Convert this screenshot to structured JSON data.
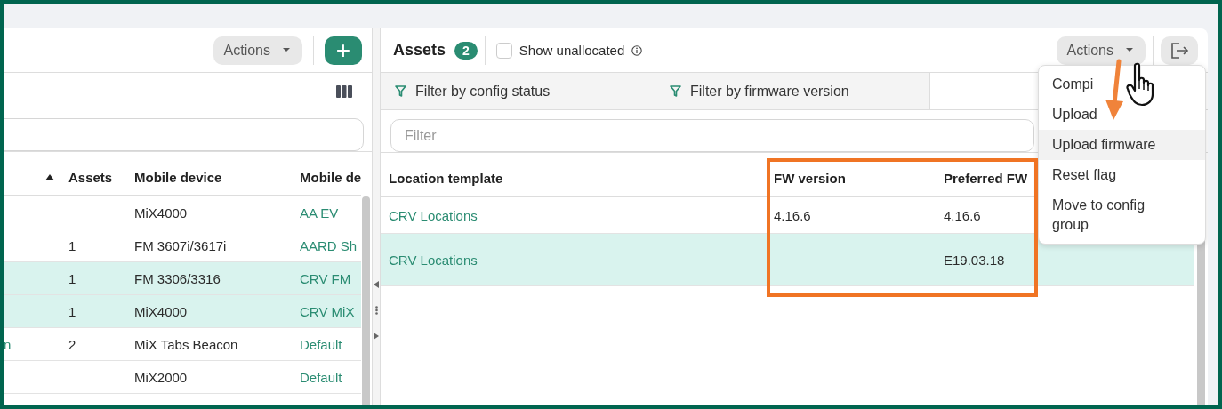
{
  "left_panel": {
    "actions_button": "Actions",
    "add_button": "+",
    "table": {
      "columns": [
        {
          "sorted": true
        },
        {
          "label": "Assets"
        },
        {
          "label": "Mobile device"
        },
        {
          "label": "Mobile de"
        }
      ],
      "rows": [
        {
          "assets": "",
          "mobile_device": "MiX4000",
          "column_4": "AA EV",
          "selected": false
        },
        {
          "assets": "1",
          "mobile_device": "FM 3607i/3617i",
          "column_4": "AARD Sh",
          "selected": false
        },
        {
          "assets": "1",
          "mobile_device": "FM 3306/3316",
          "column_4": "CRV FM",
          "selected": true
        },
        {
          "assets": "1",
          "mobile_device": "MiX4000",
          "column_4": "CRV MiX",
          "selected": true
        },
        {
          "column_1": "n",
          "assets": "2",
          "mobile_device": "MiX Tabs Beacon",
          "column_4": "Default",
          "selected": false
        },
        {
          "assets": "",
          "mobile_device": "MiX2000",
          "column_4": "Default",
          "selected": false
        }
      ]
    }
  },
  "right_panel": {
    "title": "Assets",
    "count": "2",
    "show_unallocated": {
      "label": "Show unallocated",
      "checked": false
    },
    "actions_button": "Actions",
    "filters": [
      {
        "label": "Filter by config status"
      },
      {
        "label": "Filter by firmware version"
      }
    ],
    "filter_field": {
      "placeholder": "Filter"
    },
    "table": {
      "columns": [
        {
          "label": "Location template"
        },
        {
          "label": "FW version"
        },
        {
          "label": "Preferred FW"
        }
      ],
      "rows": [
        {
          "location_template": "CRV Locations",
          "fw_version": "4.16.6",
          "preferred_fw": "4.16.6",
          "selected": false
        },
        {
          "location_template": "CRV Locations",
          "fw_version": "",
          "preferred_fw": "E19.03.18",
          "selected": true
        }
      ]
    },
    "actions_menu": [
      {
        "label": "Compi",
        "hovered": false
      },
      {
        "label": "Upload",
        "hovered": false
      },
      {
        "label": "Upload firmware",
        "hovered": true
      },
      {
        "label": "Reset flag",
        "hovered": false
      },
      {
        "label": "Move to config group",
        "hovered": false
      }
    ]
  }
}
